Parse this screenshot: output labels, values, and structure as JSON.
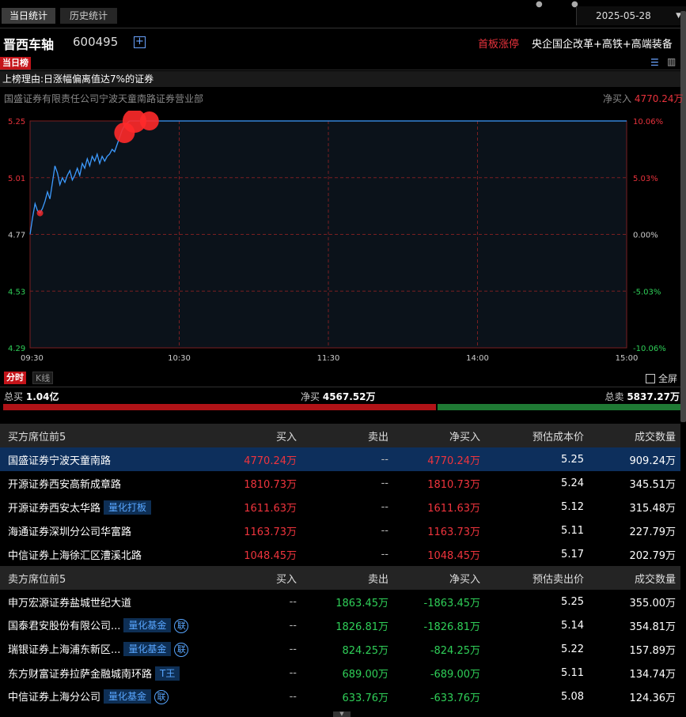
{
  "tabs": {
    "today": "当日统计",
    "history": "历史统计"
  },
  "date": "2025-05-28",
  "stock": {
    "name": "晋西车轴",
    "code": "600495",
    "tag": "首板涨停",
    "concepts": "央企国企改革+高铁+高端装备"
  },
  "board_label": "当日榜",
  "reason": "上榜理由:日涨幅偏离值达7%的证券",
  "broker_info": {
    "name": "国盛证券有限责任公司宁波天童南路证券营业部",
    "net_label": "净买入",
    "net_value": "4770.24万"
  },
  "chart_data": {
    "type": "line",
    "title": "",
    "y_labels_left": [
      "5.25",
      "5.01",
      "4.77",
      "4.53",
      "4.29"
    ],
    "y_labels_right": [
      "10.06%",
      "5.03%",
      "0.00%",
      "-5.03%",
      "-10.06%"
    ],
    "x_labels": [
      "09:30",
      "10:30",
      "11:30",
      "14:00",
      "15:00"
    ],
    "ylim": [
      4.29,
      5.25
    ],
    "prev_close": 4.77,
    "total_minutes": 240,
    "colors": {
      "line": "#3d9bff",
      "marker": "#ff2a2a",
      "up_label": "#e8323c",
      "down_label": "#2fcf58",
      "grid": "#7a1f22"
    },
    "price_points": [
      [
        0,
        4.77
      ],
      [
        1,
        4.84
      ],
      [
        2,
        4.9
      ],
      [
        3,
        4.87
      ],
      [
        4,
        4.86
      ],
      [
        5,
        4.88
      ],
      [
        6,
        4.91
      ],
      [
        7,
        4.95
      ],
      [
        8,
        4.92
      ],
      [
        9,
        4.99
      ],
      [
        10,
        5.06
      ],
      [
        11,
        5.03
      ],
      [
        12,
        4.98
      ],
      [
        13,
        5.01
      ],
      [
        14,
        4.99
      ],
      [
        15,
        5.02
      ],
      [
        16,
        5.04
      ],
      [
        17,
        5.0
      ],
      [
        18,
        5.02
      ],
      [
        19,
        5.05
      ],
      [
        20,
        5.02
      ],
      [
        21,
        5.07
      ],
      [
        22,
        5.05
      ],
      [
        23,
        5.09
      ],
      [
        24,
        5.06
      ],
      [
        25,
        5.1
      ],
      [
        26,
        5.08
      ],
      [
        27,
        5.11
      ],
      [
        28,
        5.07
      ],
      [
        29,
        5.1
      ],
      [
        30,
        5.08
      ],
      [
        31,
        5.1
      ],
      [
        32,
        5.11
      ],
      [
        33,
        5.13
      ],
      [
        34,
        5.12
      ],
      [
        35,
        5.15
      ],
      [
        36,
        5.18
      ],
      [
        37,
        5.21
      ],
      [
        38,
        5.23
      ],
      [
        39,
        5.24
      ],
      [
        40,
        5.25
      ],
      [
        240,
        5.25
      ]
    ],
    "trades": [
      {
        "t": 4,
        "price": 4.86,
        "size": 4
      },
      {
        "t": 38,
        "price": 5.2,
        "size": 13
      },
      {
        "t": 42,
        "price": 5.25,
        "size": 15
      },
      {
        "t": 48,
        "price": 5.25,
        "size": 12
      }
    ]
  },
  "controls": {
    "fenshi": "分时",
    "kline": "K线",
    "fullscreen": "全屏"
  },
  "totals": {
    "buy_label": "总买",
    "buy": "1.04亿",
    "net_label": "净买",
    "net": "4567.52万",
    "sell_label": "总卖",
    "sell": "5837.27万",
    "buy_ratio": 0.641
  },
  "buy_table": {
    "headers": [
      "买方席位前5",
      "买入",
      "卖出",
      "净买入",
      "预估成本价",
      "成交数量"
    ],
    "rows": [
      {
        "name": "国盛证券宁波天童南路",
        "badge": "",
        "lian": false,
        "buy": "4770.24万",
        "sell": "--",
        "net": "4770.24万",
        "price": "5.25",
        "qty": "909.24万"
      },
      {
        "name": "开源证券西安高新成章路",
        "badge": "",
        "lian": false,
        "buy": "1810.73万",
        "sell": "--",
        "net": "1810.73万",
        "price": "5.24",
        "qty": "345.51万"
      },
      {
        "name": "开源证券西安太华路",
        "badge": "量化打板",
        "lian": false,
        "buy": "1611.63万",
        "sell": "--",
        "net": "1611.63万",
        "price": "5.12",
        "qty": "315.48万"
      },
      {
        "name": "海通证券深圳分公司华富路",
        "badge": "",
        "lian": false,
        "buy": "1163.73万",
        "sell": "--",
        "net": "1163.73万",
        "price": "5.11",
        "qty": "227.79万"
      },
      {
        "name": "中信证券上海徐汇区漕溪北路",
        "badge": "",
        "lian": false,
        "buy": "1048.45万",
        "sell": "--",
        "net": "1048.45万",
        "price": "5.17",
        "qty": "202.79万"
      }
    ]
  },
  "sell_table": {
    "headers": [
      "卖方席位前5",
      "买入",
      "卖出",
      "净买入",
      "预估卖出价",
      "成交数量"
    ],
    "rows": [
      {
        "name": "申万宏源证券盐城世纪大道",
        "badge": "",
        "lian": false,
        "buy": "--",
        "sell": "1863.45万",
        "net": "-1863.45万",
        "price": "5.25",
        "qty": "355.00万"
      },
      {
        "name": "国泰君安股份有限公司...",
        "badge": "量化基金",
        "lian": true,
        "buy": "--",
        "sell": "1826.81万",
        "net": "-1826.81万",
        "price": "5.14",
        "qty": "354.81万"
      },
      {
        "name": "瑞银证券上海浦东新区...",
        "badge": "量化基金",
        "lian": true,
        "buy": "--",
        "sell": "824.25万",
        "net": "-824.25万",
        "price": "5.22",
        "qty": "157.89万"
      },
      {
        "name": "东方财富证券拉萨金融城南环路",
        "badge": "T王",
        "lian": false,
        "buy": "--",
        "sell": "689.00万",
        "net": "-689.00万",
        "price": "5.11",
        "qty": "134.74万"
      },
      {
        "name": "中信证券上海分公司",
        "badge": "量化基金",
        "lian": true,
        "buy": "--",
        "sell": "633.76万",
        "net": "-633.76万",
        "price": "5.08",
        "qty": "124.36万"
      }
    ]
  },
  "lian_glyph": "联"
}
